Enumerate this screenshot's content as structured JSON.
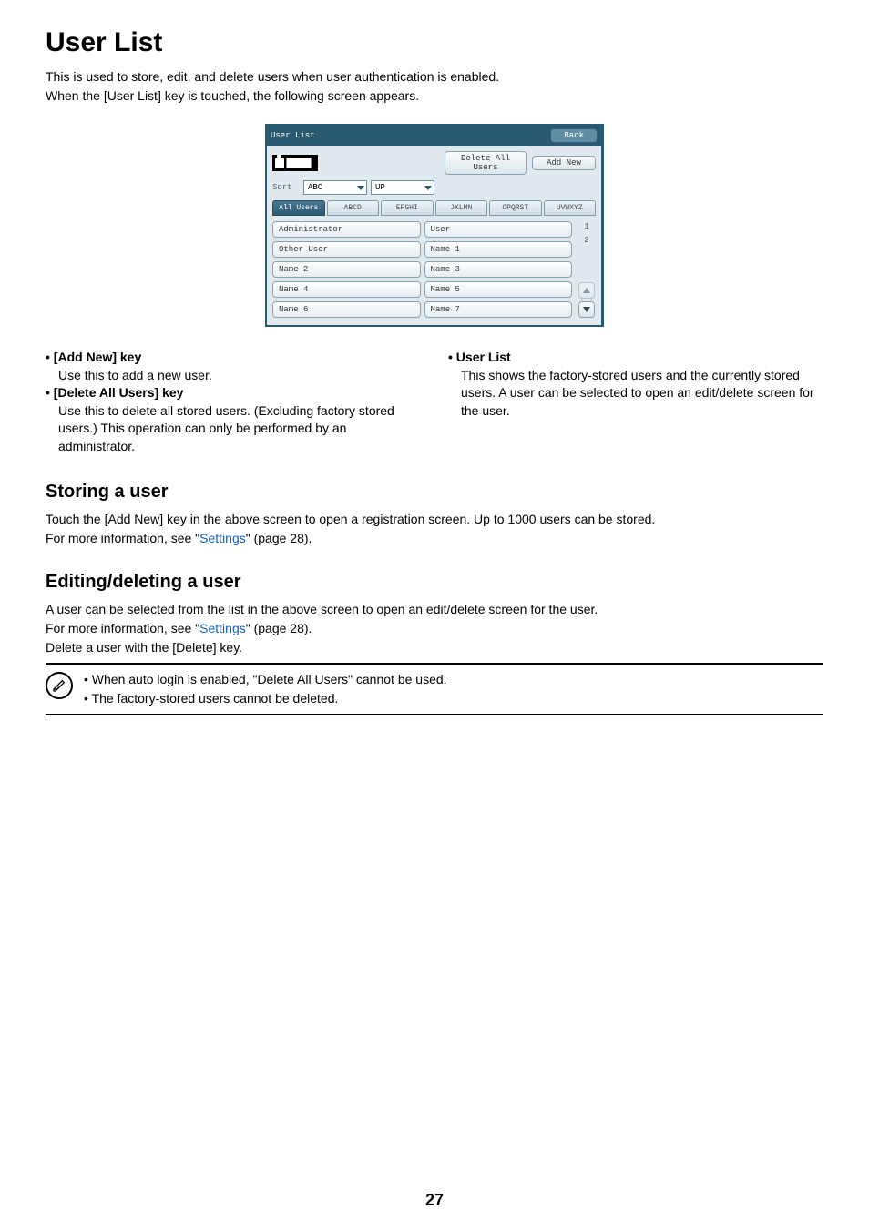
{
  "title": "User List",
  "intro_line1": "This is used to store, edit, and delete users when user authentication is enabled.",
  "intro_line2": "When the [User List] key is touched, the following screen appears.",
  "panel": {
    "header_title": "User List",
    "back": "Back",
    "delete_all": "Delete All Users",
    "add_new": "Add New",
    "sort_label": "Sort",
    "sort_value": "ABC",
    "sort_direction": "UP",
    "tabs": [
      "All Users",
      "ABCD",
      "EFGHI",
      "JKLMN",
      "OPQRST",
      "UVWXYZ"
    ],
    "left_items": [
      "Administrator",
      "Other User",
      "Name 2",
      "Name 4",
      "Name 6"
    ],
    "right_items": [
      "User",
      "Name 1",
      "Name 3",
      "Name 5",
      "Name 7"
    ],
    "page_current": "1",
    "page_total": "2"
  },
  "desc": {
    "left": [
      {
        "head": "[Add New] key",
        "body": "Use this to add a new user."
      },
      {
        "head": "[Delete All Users] key",
        "body": "Use this to delete all stored users. (Excluding factory stored users.) This operation can only be performed by an administrator."
      }
    ],
    "right": [
      {
        "head": "User List",
        "body": "This shows the factory-stored users and the currently stored users. A user can be selected to open an edit/delete screen for the user."
      }
    ]
  },
  "storing": {
    "heading": "Storing a user",
    "line1_a": "Touch the [Add New] key in the above screen to open a registration screen. Up to 1000 users can be stored.",
    "line2_a": "For more information, see \"",
    "link": "Settings",
    "line2_b": "\" (page 28)."
  },
  "editing": {
    "heading": "Editing/deleting a user",
    "line1": "A user can be selected from the list in the above screen to open an edit/delete screen for the user.",
    "line2_a": "For more information, see \"",
    "link": "Settings",
    "line2_b": "\" (page 28).",
    "line3": "Delete a user with the [Delete] key."
  },
  "notes": [
    "When auto login is enabled, \"Delete All Users\" cannot be used.",
    "The factory-stored users cannot be deleted."
  ],
  "page_number": "27"
}
